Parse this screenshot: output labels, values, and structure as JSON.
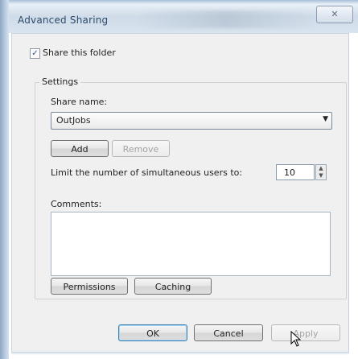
{
  "window": {
    "title": "Advanced Sharing",
    "close_glyph": "✕"
  },
  "share_folder": {
    "label": "Share this folder",
    "checked": true,
    "check_glyph": "✓"
  },
  "settings": {
    "group_label": "Settings",
    "share_name_label": "Share name:",
    "share_name_value": "OutJobs",
    "add_label": "Add",
    "remove_label": "Remove",
    "limit_label": "Limit the number of simultaneous users to:",
    "limit_value": "10",
    "comments_label": "Comments:",
    "comments_value": "",
    "permissions_label": "Permissions",
    "caching_label": "Caching"
  },
  "footer": {
    "ok_label": "OK",
    "cancel_label": "Cancel",
    "apply_label": "Apply"
  },
  "colors": {
    "accent": "#3c7fb1",
    "panel": "#f0f0f0"
  },
  "icons": {
    "close": "close-icon",
    "dropdown": "chevron-down-icon",
    "spin_up": "spin-up-icon",
    "spin_down": "spin-down-icon",
    "cursor": "mouse-pointer-icon"
  }
}
